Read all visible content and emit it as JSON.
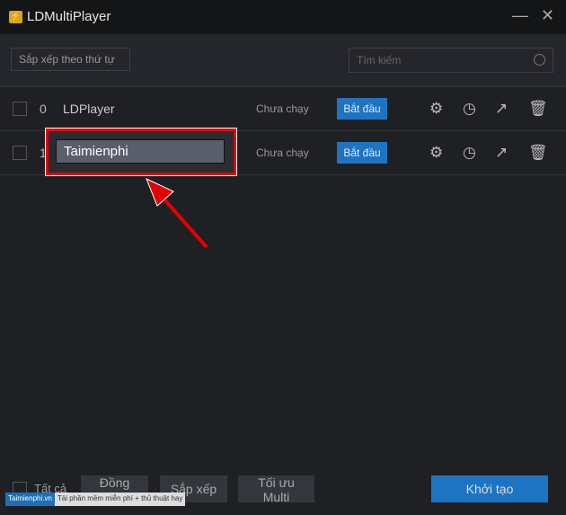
{
  "window": {
    "title": "LDMultiPlayer",
    "minimize": "—",
    "close": "✕"
  },
  "toolbar": {
    "sort_label": "Sắp xếp theo thứ tự",
    "search_placeholder": "Tìm kiếm"
  },
  "rows": [
    {
      "index": "0",
      "name": "LDPlayer",
      "status": "Chưa chạy",
      "start": "Bắt đầu"
    },
    {
      "index": "1",
      "name": "Taimienphi",
      "status": "Chưa chạy",
      "start": "Bắt đầu"
    }
  ],
  "bottom": {
    "select_all": "Tất cả",
    "batch": "Đồng loạt",
    "arrange": "Sắp xếp",
    "optimize": "Tối ưu Multi",
    "create": "Khởi tạo"
  },
  "watermark": {
    "brand": "Taimienphi.vn",
    "tagline": "Tải phần mềm miễn phí + thủ thuật hay"
  }
}
